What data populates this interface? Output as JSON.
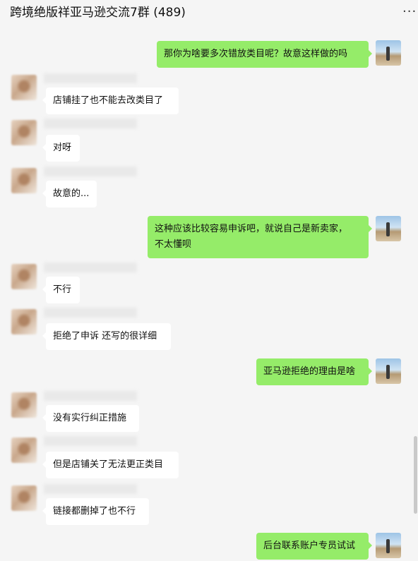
{
  "header": {
    "title": "跨境绝版祥亚马逊交流7群 (489)",
    "more_icon": "ellipsis-icon"
  },
  "messages": [
    {
      "side": "out",
      "text": "那你为啥要多次错放类目呢？故意这样做的吗"
    },
    {
      "side": "in",
      "text": "店铺挂了也不能去改类目了"
    },
    {
      "side": "in",
      "text": "对呀"
    },
    {
      "side": "in",
      "text": "故意的..."
    },
    {
      "side": "out",
      "text": "这种应该比较容易申诉吧，就说自己是新卖家，\n不太懂呗"
    },
    {
      "side": "in",
      "text": "不行"
    },
    {
      "side": "in",
      "text": "拒绝了申诉 还写的很详细"
    },
    {
      "side": "out",
      "text": "亚马逊拒绝的理由是啥"
    },
    {
      "side": "in",
      "text": "没有实行纠正措施"
    },
    {
      "side": "in",
      "text": "但是店铺关了无法更正类目"
    },
    {
      "side": "in",
      "text": "链接都删掉了也不行"
    },
    {
      "side": "out",
      "text": "后台联系账户专员试试"
    }
  ],
  "colors": {
    "outgoing_bubble": "#95ec69",
    "incoming_bubble": "#ffffff",
    "background": "#f5f5f5"
  }
}
